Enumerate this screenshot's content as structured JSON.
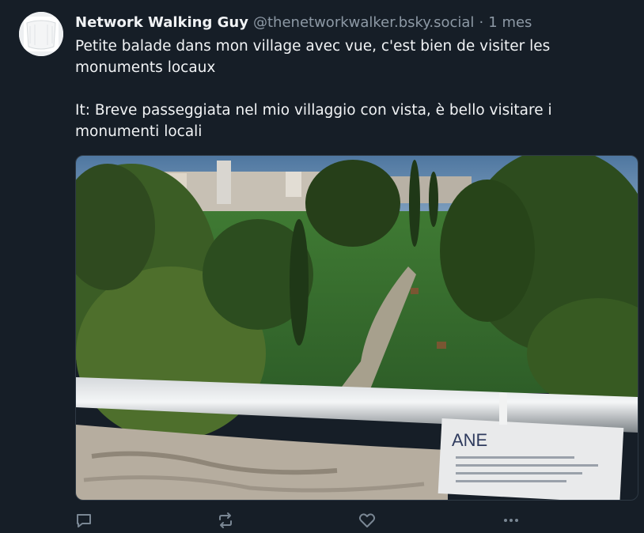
{
  "post": {
    "author": {
      "display_name": "Network Walking Guy",
      "handle": "@thenetworkwalker.bsky.social"
    },
    "separator": "·",
    "time": "1 mes",
    "text_fr": "Petite balade dans mon village avec vue, c'est bien de visiter les monuments locaux",
    "text_it": "It: Breve passeggiata nel mio villaggio con vista, è bello visitare i monumenti locali",
    "image": {
      "sign_text": "ANE"
    }
  },
  "actions": {
    "icons": [
      "reply-icon",
      "repost-icon",
      "like-icon",
      "more-icon"
    ]
  },
  "colors": {
    "background": "#161e27",
    "text": "#f1f3f5",
    "muted": "#8d99a5",
    "icon": "#7a8794"
  }
}
